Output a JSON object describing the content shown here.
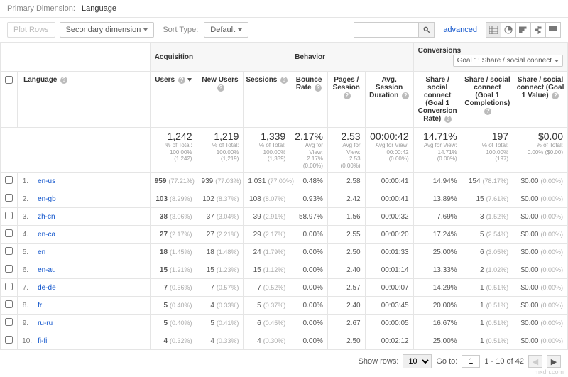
{
  "primaryDimension": {
    "label": "Primary Dimension:",
    "value": "Language"
  },
  "toolbar": {
    "plotRows": "Plot Rows",
    "secondaryDimension": "Secondary dimension",
    "sortTypeLabel": "Sort Type:",
    "sortTypeValue": "Default",
    "advanced": "advanced"
  },
  "groups": {
    "acquisition": "Acquisition",
    "behavior": "Behavior",
    "conversions": "Conversions",
    "goalSelector": "Goal 1: Share / social connect"
  },
  "columns": {
    "language": "Language",
    "users": "Users",
    "newUsers": "New Users",
    "sessions": "Sessions",
    "bounceRate": "Bounce Rate",
    "pagesSession": "Pages / Session",
    "avgDuration": "Avg. Session Duration",
    "goalRate": "Share / social connect (Goal 1 Conversion Rate)",
    "goalCompletions": "Share / social connect (Goal 1 Completions)",
    "goalValue": "Share / social connect (Goal 1 Value)"
  },
  "summary": {
    "users": {
      "v": "1,242",
      "sub1": "% of Total:",
      "sub2": "100.00%",
      "sub3": "(1,242)"
    },
    "newUsers": {
      "v": "1,219",
      "sub1": "% of Total:",
      "sub2": "100.00%",
      "sub3": "(1,219)"
    },
    "sessions": {
      "v": "1,339",
      "sub1": "% of Total:",
      "sub2": "100.00% (1,339)"
    },
    "bounce": {
      "v": "2.17%",
      "sub1": "Avg for View:",
      "sub2": "2.17%",
      "sub3": "(0.00%)"
    },
    "pages": {
      "v": "2.53",
      "sub1": "Avg for View:",
      "sub2": "2.53",
      "sub3": "(0.00%)"
    },
    "duration": {
      "v": "00:00:42",
      "sub1": "Avg for View:",
      "sub2": "00:00:42",
      "sub3": "(0.00%)"
    },
    "goalRate": {
      "v": "14.71%",
      "sub1": "Avg for View:",
      "sub2": "14.71%",
      "sub3": "(0.00%)"
    },
    "goalCompletions": {
      "v": "197",
      "sub1": "% of Total:",
      "sub2": "100.00%",
      "sub3": "(197)"
    },
    "goalValue": {
      "v": "$0.00",
      "sub1": "% of Total:",
      "sub2": "0.00% ($0.00)"
    }
  },
  "rows": [
    {
      "i": "1.",
      "lang": "en-us",
      "users": "959",
      "usersPct": "(77.21%)",
      "newUsers": "939",
      "newUsersPct": "(77.03%)",
      "sessions": "1,031",
      "sessionsPct": "(77.00%)",
      "bounce": "0.48%",
      "pages": "2.58",
      "dur": "00:00:41",
      "gr": "14.94%",
      "gc": "154",
      "gcPct": "(78.17%)",
      "gv": "$0.00",
      "gvPct": "(0.00%)"
    },
    {
      "i": "2.",
      "lang": "en-gb",
      "users": "103",
      "usersPct": "(8.29%)",
      "newUsers": "102",
      "newUsersPct": "(8.37%)",
      "sessions": "108",
      "sessionsPct": "(8.07%)",
      "bounce": "0.93%",
      "pages": "2.42",
      "dur": "00:00:41",
      "gr": "13.89%",
      "gc": "15",
      "gcPct": "(7.61%)",
      "gv": "$0.00",
      "gvPct": "(0.00%)"
    },
    {
      "i": "3.",
      "lang": "zh-cn",
      "users": "38",
      "usersPct": "(3.06%)",
      "newUsers": "37",
      "newUsersPct": "(3.04%)",
      "sessions": "39",
      "sessionsPct": "(2.91%)",
      "bounce": "58.97%",
      "pages": "1.56",
      "dur": "00:00:32",
      "gr": "7.69%",
      "gc": "3",
      "gcPct": "(1.52%)",
      "gv": "$0.00",
      "gvPct": "(0.00%)"
    },
    {
      "i": "4.",
      "lang": "en-ca",
      "users": "27",
      "usersPct": "(2.17%)",
      "newUsers": "27",
      "newUsersPct": "(2.21%)",
      "sessions": "29",
      "sessionsPct": "(2.17%)",
      "bounce": "0.00%",
      "pages": "2.55",
      "dur": "00:00:20",
      "gr": "17.24%",
      "gc": "5",
      "gcPct": "(2.54%)",
      "gv": "$0.00",
      "gvPct": "(0.00%)"
    },
    {
      "i": "5.",
      "lang": "en",
      "users": "18",
      "usersPct": "(1.45%)",
      "newUsers": "18",
      "newUsersPct": "(1.48%)",
      "sessions": "24",
      "sessionsPct": "(1.79%)",
      "bounce": "0.00%",
      "pages": "2.50",
      "dur": "00:01:33",
      "gr": "25.00%",
      "gc": "6",
      "gcPct": "(3.05%)",
      "gv": "$0.00",
      "gvPct": "(0.00%)"
    },
    {
      "i": "6.",
      "lang": "en-au",
      "users": "15",
      "usersPct": "(1.21%)",
      "newUsers": "15",
      "newUsersPct": "(1.23%)",
      "sessions": "15",
      "sessionsPct": "(1.12%)",
      "bounce": "0.00%",
      "pages": "2.40",
      "dur": "00:01:14",
      "gr": "13.33%",
      "gc": "2",
      "gcPct": "(1.02%)",
      "gv": "$0.00",
      "gvPct": "(0.00%)"
    },
    {
      "i": "7.",
      "lang": "de-de",
      "users": "7",
      "usersPct": "(0.56%)",
      "newUsers": "7",
      "newUsersPct": "(0.57%)",
      "sessions": "7",
      "sessionsPct": "(0.52%)",
      "bounce": "0.00%",
      "pages": "2.57",
      "dur": "00:00:07",
      "gr": "14.29%",
      "gc": "1",
      "gcPct": "(0.51%)",
      "gv": "$0.00",
      "gvPct": "(0.00%)"
    },
    {
      "i": "8.",
      "lang": "fr",
      "users": "5",
      "usersPct": "(0.40%)",
      "newUsers": "4",
      "newUsersPct": "(0.33%)",
      "sessions": "5",
      "sessionsPct": "(0.37%)",
      "bounce": "0.00%",
      "pages": "2.40",
      "dur": "00:03:45",
      "gr": "20.00%",
      "gc": "1",
      "gcPct": "(0.51%)",
      "gv": "$0.00",
      "gvPct": "(0.00%)"
    },
    {
      "i": "9.",
      "lang": "ru-ru",
      "users": "5",
      "usersPct": "(0.40%)",
      "newUsers": "5",
      "newUsersPct": "(0.41%)",
      "sessions": "6",
      "sessionsPct": "(0.45%)",
      "bounce": "0.00%",
      "pages": "2.67",
      "dur": "00:00:05",
      "gr": "16.67%",
      "gc": "1",
      "gcPct": "(0.51%)",
      "gv": "$0.00",
      "gvPct": "(0.00%)"
    },
    {
      "i": "10.",
      "lang": "fi-fi",
      "users": "4",
      "usersPct": "(0.32%)",
      "newUsers": "4",
      "newUsersPct": "(0.33%)",
      "sessions": "4",
      "sessionsPct": "(0.30%)",
      "bounce": "0.00%",
      "pages": "2.50",
      "dur": "00:02:12",
      "gr": "25.00%",
      "gc": "1",
      "gcPct": "(0.51%)",
      "gv": "$0.00",
      "gvPct": "(0.00%)"
    }
  ],
  "pager": {
    "showRows": "Show rows:",
    "rows": "10",
    "goTo": "Go to:",
    "page": "1",
    "range": "1 - 10 of 42"
  },
  "watermark": "mxdn.com"
}
